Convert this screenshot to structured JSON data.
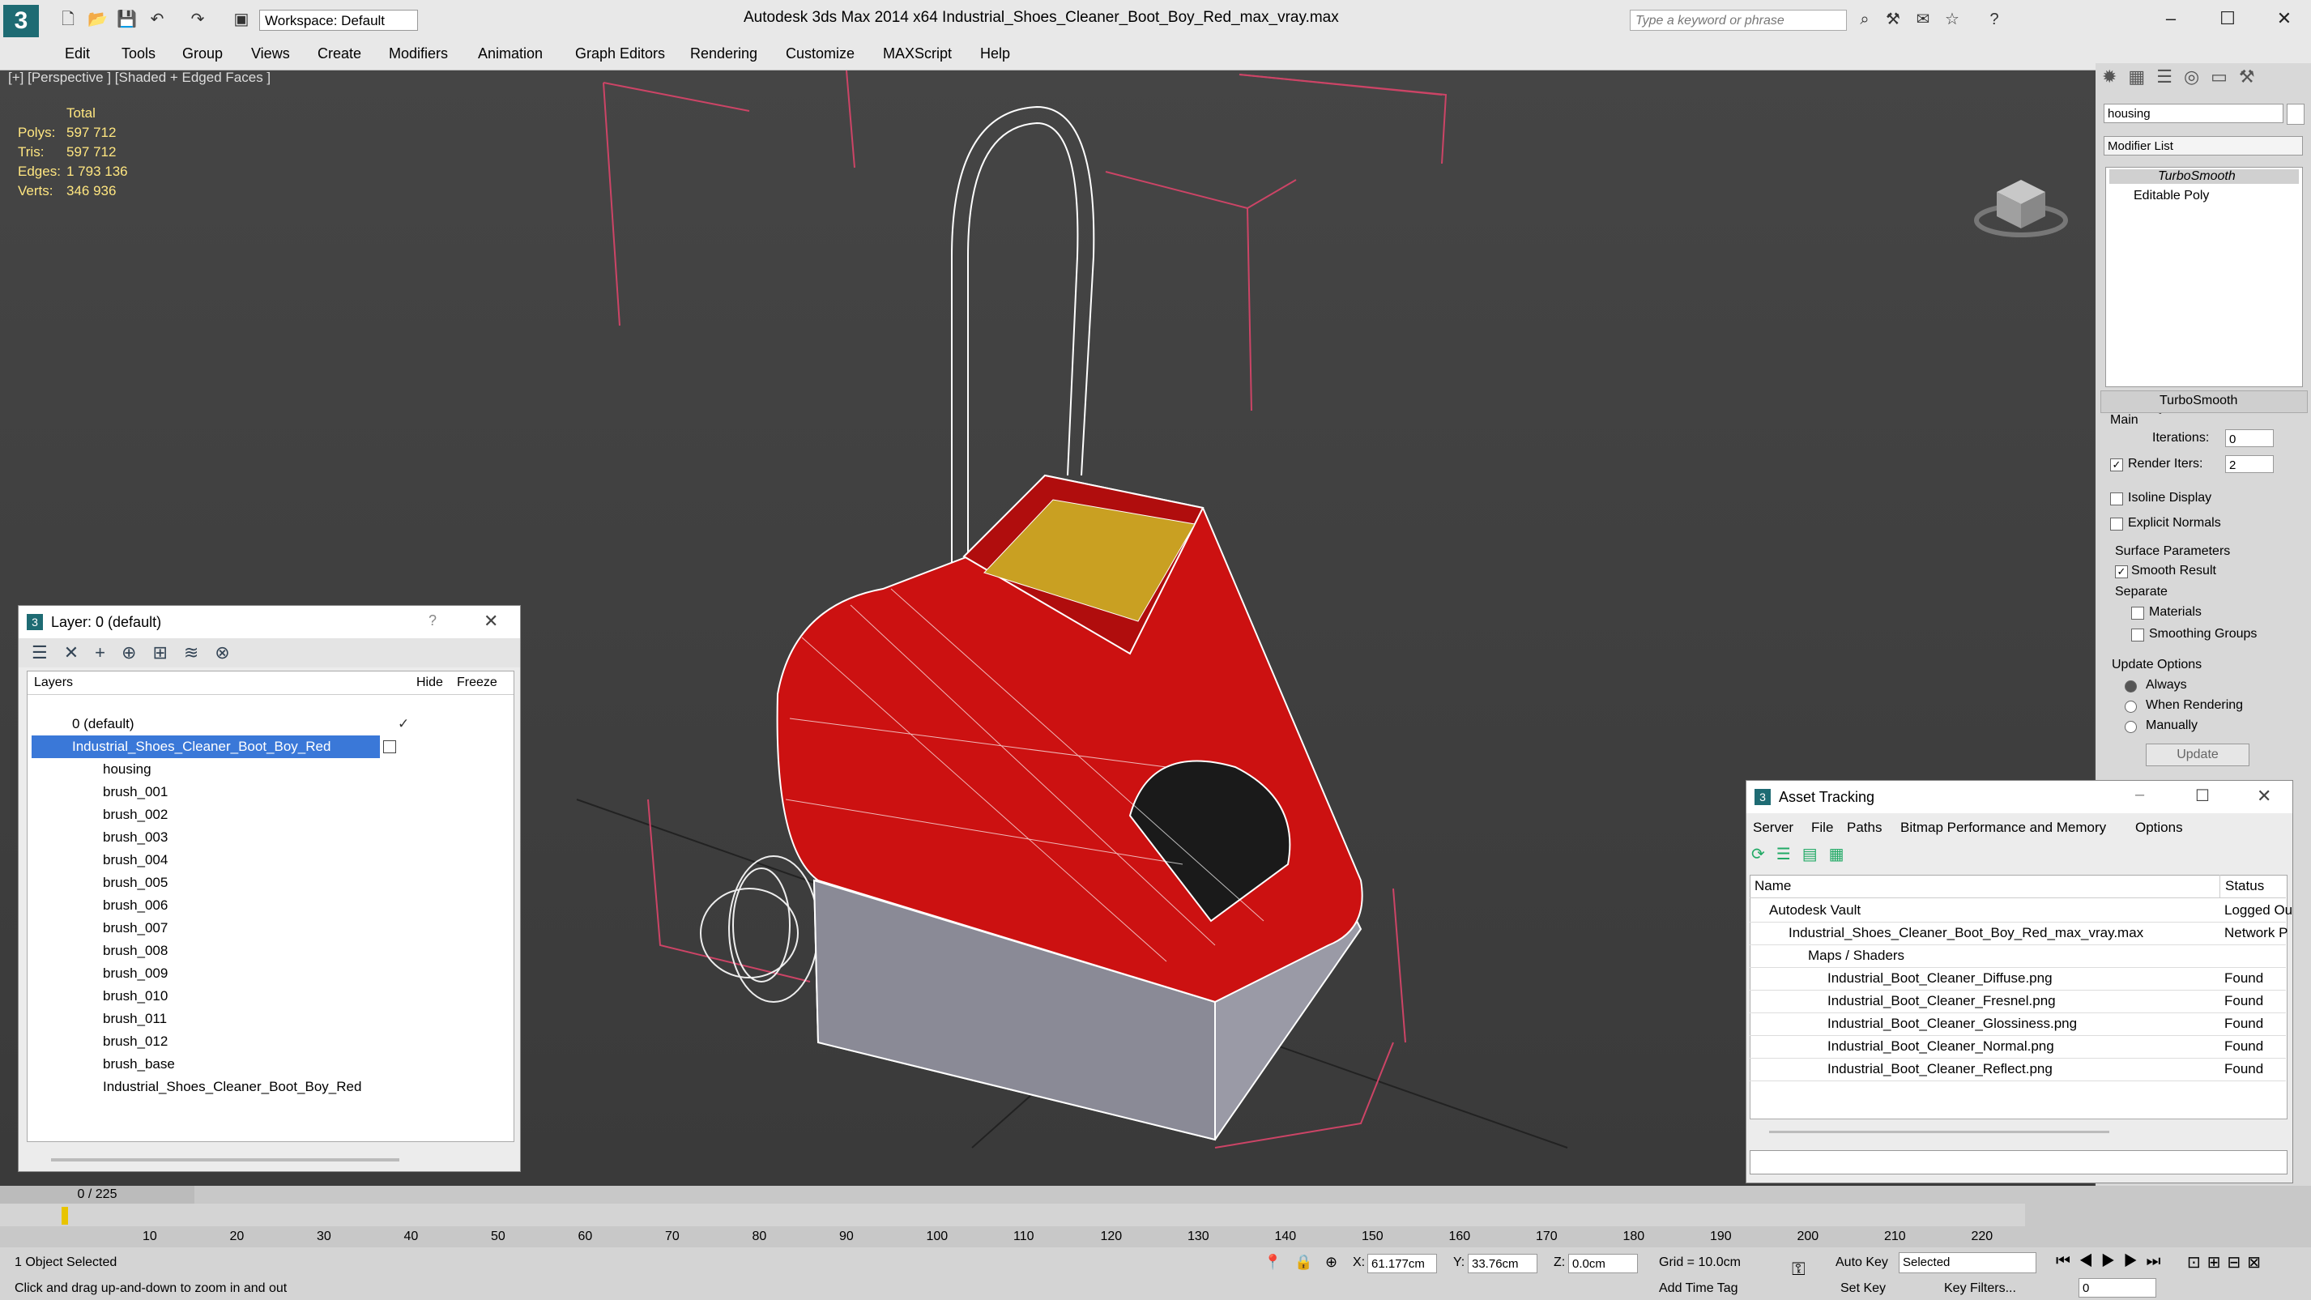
{
  "app": {
    "title": "Autodesk 3ds Max  2014 x64     Industrial_Shoes_Cleaner_Boot_Boy_Red_max_vray.max",
    "logo_letter": "3",
    "workspace": "Workspace: Default",
    "search_placeholder": "Type a keyword or phrase"
  },
  "menu": [
    "Edit",
    "Tools",
    "Group",
    "Views",
    "Create",
    "Modifiers",
    "Animation",
    "Graph Editors",
    "Rendering",
    "Customize",
    "MAXScript",
    "Help"
  ],
  "viewport": {
    "label": "[+] [Perspective ] [Shaded + Edged Faces ]",
    "stats_header": "Total",
    "stats": [
      {
        "k": "Polys:",
        "v": "597 712"
      },
      {
        "k": "Tris:",
        "v": "597 712"
      },
      {
        "k": "Edges:",
        "v": "1 793 136"
      },
      {
        "k": "Verts:",
        "v": "346 936"
      }
    ],
    "colors": {
      "body": "#cc1111",
      "wire": "#ffffff",
      "box": "#cc4466",
      "label": "#c9a022"
    }
  },
  "command_panel": {
    "object_name": "housing",
    "modifier_list": "Modifier List",
    "stack": [
      "TurboSmooth",
      "Editable Poly"
    ],
    "rollout_title": "TurboSmooth",
    "main": "Main",
    "iterations_label": "Iterations:",
    "iterations_value": "0",
    "render_iters_label": "Render Iters:",
    "render_iters_value": "2",
    "isoline": "Isoline Display",
    "explicit_normals": "Explicit Normals",
    "surface_params": "Surface Parameters",
    "smooth_result": "Smooth Result",
    "separate": "Separate",
    "materials": "Materials",
    "smoothing_groups": "Smoothing Groups",
    "update_options": "Update Options",
    "always": "Always",
    "when_rendering": "When Rendering",
    "manually": "Manually",
    "update_btn": "Update"
  },
  "layer_window": {
    "title": "Layer: 0 (default)",
    "help": "?",
    "col_layers": "Layers",
    "col_hide": "Hide",
    "col_freeze": "Freeze",
    "rows": [
      "0 (default)",
      "Industrial_Shoes_Cleaner_Boot_Boy_Red",
      "housing",
      "brush_001",
      "brush_002",
      "brush_003",
      "brush_004",
      "brush_005",
      "brush_006",
      "brush_007",
      "brush_008",
      "brush_009",
      "brush_010",
      "brush_011",
      "brush_012",
      "brush_base",
      "Industrial_Shoes_Cleaner_Boot_Boy_Red"
    ]
  },
  "asset_window": {
    "title": "Asset Tracking",
    "menus": [
      "Server",
      "File",
      "Paths",
      "Bitmap Performance and Memory",
      "Options"
    ],
    "col_name": "Name",
    "col_status": "Status",
    "rows": [
      {
        "name": "Autodesk Vault",
        "status": "Logged Ou",
        "indent": 1
      },
      {
        "name": "Industrial_Shoes_Cleaner_Boot_Boy_Red_max_vray.max",
        "status": "Network P",
        "indent": 2
      },
      {
        "name": "Maps / Shaders",
        "status": "",
        "indent": 3
      },
      {
        "name": "Industrial_Boot_Cleaner_Diffuse.png",
        "status": "Found",
        "indent": 4
      },
      {
        "name": "Industrial_Boot_Cleaner_Fresnel.png",
        "status": "Found",
        "indent": 4
      },
      {
        "name": "Industrial_Boot_Cleaner_Glossiness.png",
        "status": "Found",
        "indent": 4
      },
      {
        "name": "Industrial_Boot_Cleaner_Normal.png",
        "status": "Found",
        "indent": 4
      },
      {
        "name": "Industrial_Boot_Cleaner_Reflect.png",
        "status": "Found",
        "indent": 4
      }
    ]
  },
  "timeline": {
    "frame": "0 / 225",
    "ticks": [
      "10",
      "20",
      "30",
      "40",
      "50",
      "60",
      "70",
      "80",
      "90",
      "100",
      "110",
      "120",
      "130",
      "140",
      "150",
      "160",
      "170",
      "180",
      "190",
      "200",
      "210",
      "220"
    ]
  },
  "status": {
    "selected": "1 Object Selected",
    "hint": "Click and drag up-and-down to zoom in and out",
    "x_label": "X:",
    "x_value": "61.177cm",
    "y_label": "Y:",
    "y_value": "33.76cm",
    "z_label": "Z:",
    "z_value": "0.0cm",
    "grid": "Grid = 10.0cm",
    "auto_key": "Auto Key",
    "selected_dropdown": "Selected",
    "set_key": "Set Key",
    "key_filters": "Key Filters...",
    "add_time_tag": "Add Time Tag",
    "frame_value": "0"
  }
}
